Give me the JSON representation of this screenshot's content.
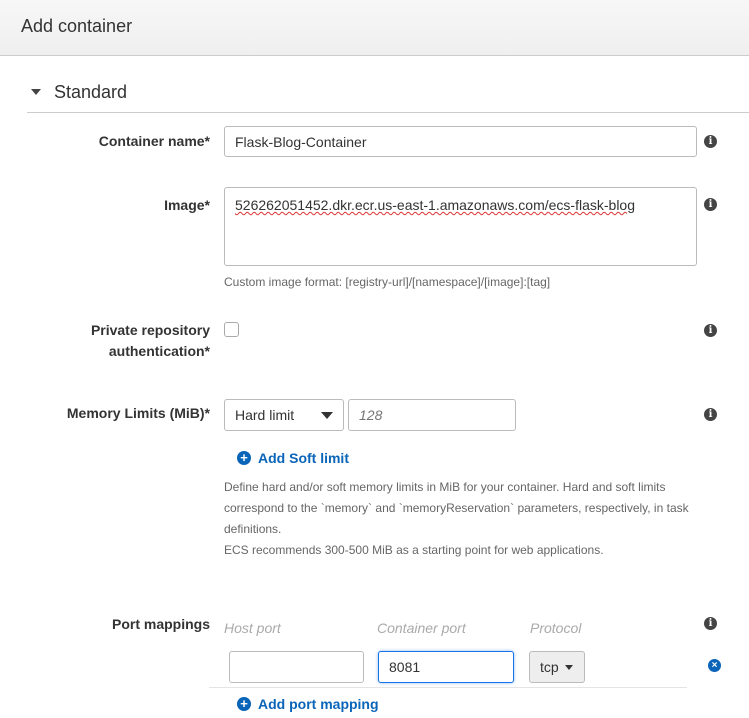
{
  "header": {
    "title": "Add container"
  },
  "section": {
    "title": "Standard"
  },
  "container_name": {
    "label": "Container name*",
    "value": "Flask-Blog-Container"
  },
  "image": {
    "label": "Image*",
    "value": "526262051452.dkr.ecr.us-east-1.amazonaws.com/ecs-flask-blog",
    "help": "Custom image format: [registry-url]/[namespace]/[image]:[tag]"
  },
  "private_repo": {
    "label_line1": "Private repository",
    "label_line2": "authentication*",
    "checked": false
  },
  "memory": {
    "label": "Memory Limits (MiB)*",
    "limit_type": "Hard limit",
    "placeholder": "128",
    "add_soft": "Add Soft limit",
    "help1": "Define hard and/or soft memory limits in MiB for your container. Hard and soft limits",
    "help2": "correspond to the `memory` and `memoryReservation` parameters, respectively, in task",
    "help3": "definitions.",
    "help4": "ECS recommends 300-500 MiB as a starting point for web applications."
  },
  "ports": {
    "label": "Port mappings",
    "host_header": "Host port",
    "container_header": "Container port",
    "protocol_header": "Protocol",
    "host_value": "",
    "container_value": "8081",
    "protocol": "tcp",
    "add": "Add port mapping"
  },
  "colors": {
    "link": "#0a64b8",
    "focus": "#1a73e8"
  }
}
